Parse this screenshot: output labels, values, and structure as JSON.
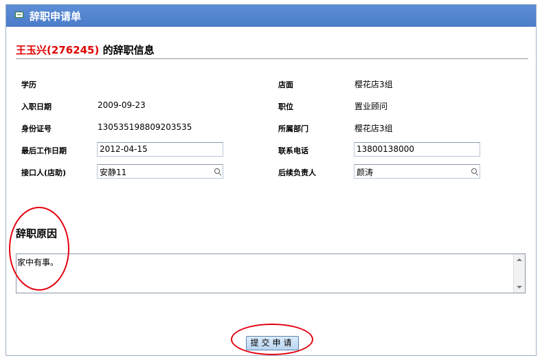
{
  "window": {
    "title": "辞职申请单"
  },
  "header": {
    "name": "王玉兴(276245)",
    "suffix": " 的辞职信息"
  },
  "form": {
    "education_label": "学历",
    "education_value": "",
    "store_label": "店面",
    "store_value": "樱花店3组",
    "join_date_label": "入职日期",
    "join_date_value": "2009-09-23",
    "position_label": "职位",
    "position_value": "置业顾问",
    "id_label": "身份证号",
    "id_value": "130535198809203535",
    "dept_label": "所属部门",
    "dept_value": "樱花店3组",
    "last_day_label": "最后工作日期",
    "last_day_value": "2012-04-15",
    "phone_label": "联系电话",
    "phone_value": "13800138000",
    "contact_label": "接口人(店助)",
    "contact_value": "安静11",
    "successor_label": "后续负责人",
    "successor_value": "颜涛"
  },
  "reason": {
    "title": "辞职原因",
    "text": "家中有事。"
  },
  "actions": {
    "submit_label": "提交申请"
  },
  "colors": {
    "titlebar": "#4a7cc9",
    "name_red": "#e00000",
    "annotation_red": "#e4000f"
  }
}
